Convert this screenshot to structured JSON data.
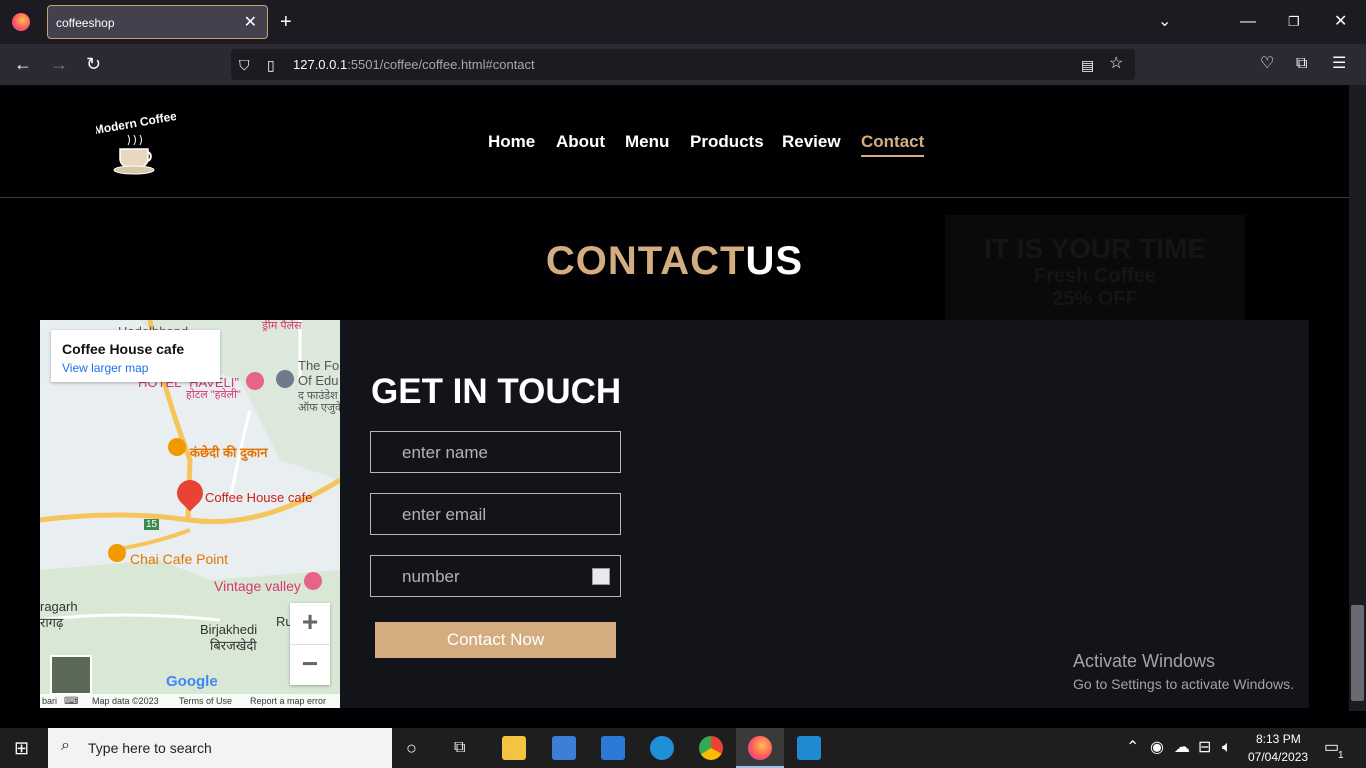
{
  "browser": {
    "tab_title": "coffeeshop",
    "url_host": "127.0.0.1",
    "url_rest": ":5501/coffee/coffee.html#contact"
  },
  "site": {
    "logo_text": "Modern Coffee",
    "nav": [
      {
        "label": "Home"
      },
      {
        "label": "About"
      },
      {
        "label": "Menu"
      },
      {
        "label": "Products"
      },
      {
        "label": "Review"
      },
      {
        "label": "Contact"
      }
    ],
    "heading_part1": "CONTACT",
    "heading_part2": "US",
    "ghost_line1": "IT IS YOUR TIME",
    "ghost_line2": "Fresh Coffee",
    "ghost_line3": "25% OFF"
  },
  "map": {
    "card_title": "Coffee House cafe",
    "card_link": "View larger map",
    "labels": {
      "top": "Hadolbhand",
      "hotel": "HOTEL \"HAVELI\"",
      "hotel_hi": "होटल \"हवेली\"",
      "found1": "The Fo",
      "found2": "Of Edu",
      "found3": "द फाउंडेश",
      "found4": "ऑफ एजुके",
      "shop": "कंछेदी की दुकान",
      "cafe": "Coffee House cafe",
      "chai": "Chai Cafe Point",
      "vintage": "Vintage valley",
      "garh": "ragarh",
      "garh_hi": "रागढ़",
      "birj": "Birjakhedi",
      "birj_hi": "बिरजखेदी",
      "ru": "Ru",
      "road": "15",
      "dream": "ड्रीम पैलेस",
      "bari": "bari"
    },
    "google": "Google",
    "footer_data": "Map data ©2023",
    "footer_terms": "Terms of Use",
    "footer_report": "Report a map error"
  },
  "form": {
    "title": "GET IN TOUCH",
    "name_placeholder": "enter name",
    "email_placeholder": "enter email",
    "number_placeholder": "number",
    "submit": "Contact Now"
  },
  "watermark": {
    "line1": "Activate Windows",
    "line2": "Go to Settings to activate Windows."
  },
  "taskbar": {
    "search_placeholder": "Type here to search",
    "time": "8:13 PM",
    "date": "07/04/2023",
    "notif_count": "1"
  }
}
